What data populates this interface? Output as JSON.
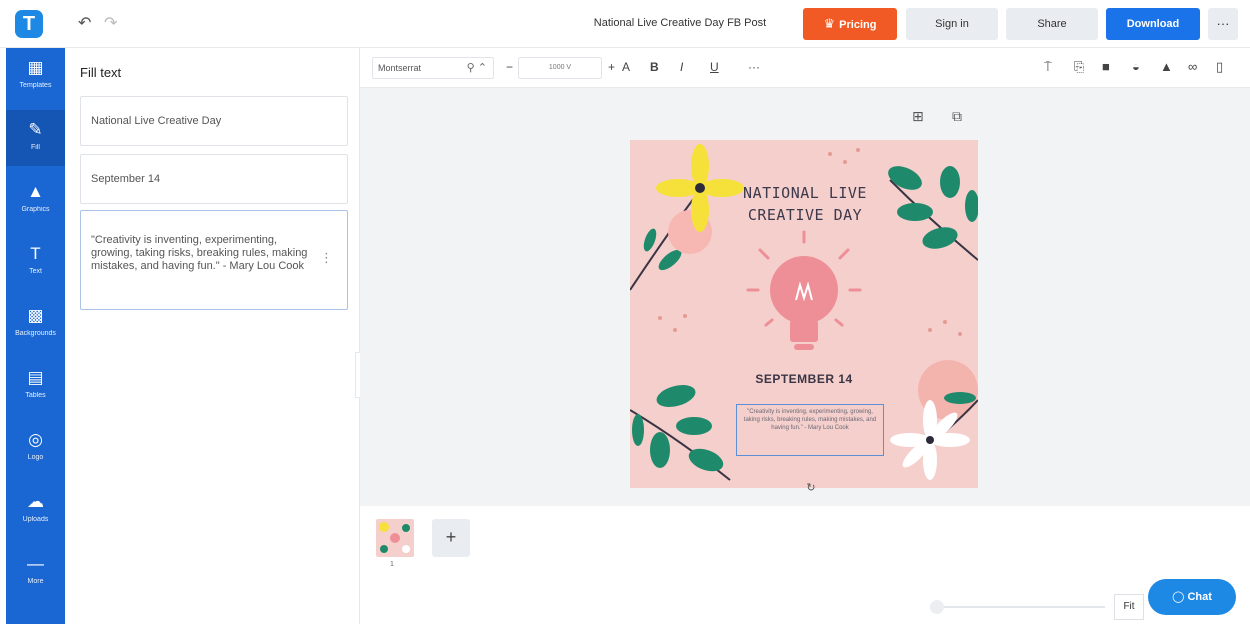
{
  "app": {
    "logo_letter": "T"
  },
  "header": {
    "title": "National Live Creative Day FB Post",
    "pricing_label": "Pricing",
    "signin_label": "Sign in",
    "share_label": "Share",
    "download_label": "Download",
    "more_label": "···",
    "pricing_color": "#f15a24",
    "download_color": "#1a73e8"
  },
  "sidebar": {
    "items": [
      {
        "label": "Templates",
        "icon": "grid-icon"
      },
      {
        "label": "Fill",
        "icon": "pencil-icon"
      },
      {
        "label": "Graphics",
        "icon": "shapes-icon"
      },
      {
        "label": "Text",
        "icon": "text-icon"
      },
      {
        "label": "Backgrounds",
        "icon": "background-icon"
      },
      {
        "label": "Tables",
        "icon": "table-icon"
      },
      {
        "label": "Logo",
        "icon": "logo-icon"
      },
      {
        "label": "Uploads",
        "icon": "cloud-upload-icon"
      },
      {
        "label": "More",
        "icon": "more-icon"
      }
    ],
    "color": "#1a66d2"
  },
  "panel": {
    "title": "Fill text",
    "fields": [
      "National Live Creative Day",
      "September 14",
      "\"Creativity is inventing, experimenting, growing, taking risks, breaking rules, making mistakes, and having fun.\" - Mary Lou Cook"
    ]
  },
  "toolbar": {
    "font_name": "Montserrat",
    "font_size": "1000 V"
  },
  "design": {
    "title": "NATIONAL LIVE CREATIVE DAY",
    "date": "SEPTEMBER 14",
    "quote": "\"Creativity is inventing, experimenting, growing, taking risks, breaking rules, making mistakes, and having fun.\" - Mary Lou Cook",
    "background": "#f5cfcc"
  },
  "pages": {
    "current": "1",
    "add_label": "+",
    "fit_label": "Fit"
  },
  "chat": {
    "label": "Chat"
  }
}
